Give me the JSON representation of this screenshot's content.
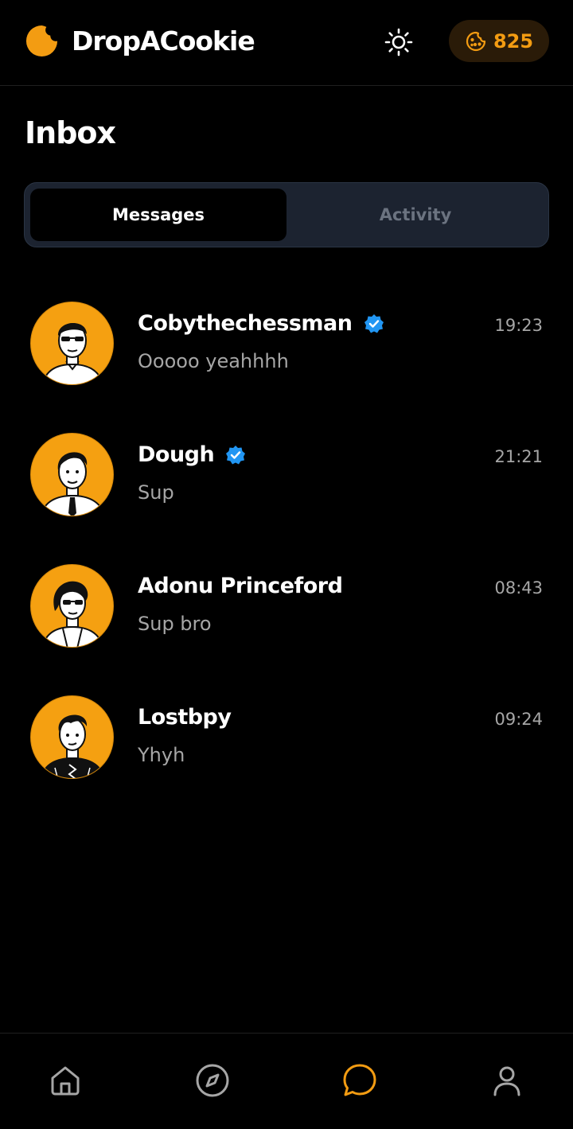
{
  "header": {
    "app_name": "DropACookie",
    "logo_icon": "cookie-logo-icon",
    "theme_icon": "sun-icon",
    "cookie_icon": "cookie-icon",
    "cookie_count": "825"
  },
  "page": {
    "title": "Inbox"
  },
  "tabs": [
    {
      "label": "Messages",
      "active": true
    },
    {
      "label": "Activity",
      "active": false
    }
  ],
  "conversations": [
    {
      "name": "Cobythechessman",
      "verified": true,
      "message": "Ooooo yeahhhh",
      "time": "19:23"
    },
    {
      "name": "Dough",
      "verified": true,
      "message": "Sup",
      "time": "21:21"
    },
    {
      "name": "Adonu Princeford",
      "verified": false,
      "message": "Sup bro",
      "time": "08:43"
    },
    {
      "name": "Lostbpy",
      "verified": false,
      "message": "Yhyh",
      "time": "09:24"
    }
  ],
  "bottom_nav": [
    {
      "icon": "home-icon",
      "active": false
    },
    {
      "icon": "compass-icon",
      "active": false
    },
    {
      "icon": "chat-bubble-icon",
      "active": true
    },
    {
      "icon": "user-icon",
      "active": false
    }
  ],
  "colors": {
    "accent": "#f39c12",
    "background": "#000000",
    "muted_text": "#a6a6a6",
    "tab_bar": "#1c2330",
    "verified_blue": "#2196f3"
  }
}
